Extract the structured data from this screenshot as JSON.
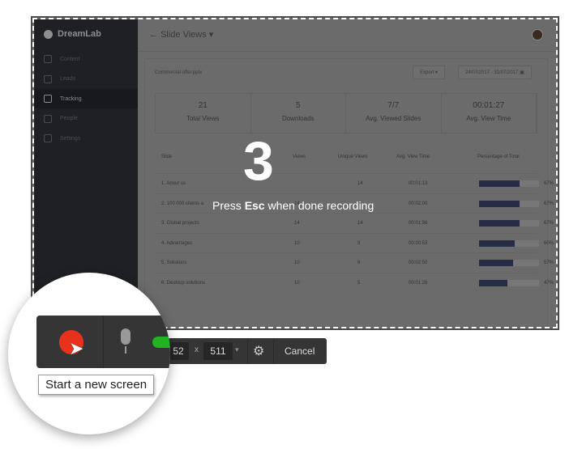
{
  "app": {
    "name": "DreamLab",
    "page_title": "Slide Views"
  },
  "sidebar": {
    "items": [
      {
        "label": "Content",
        "icon": "file-icon"
      },
      {
        "label": "Leads",
        "icon": "target-icon"
      },
      {
        "label": "Tracking",
        "icon": "chart-icon",
        "selected": true
      },
      {
        "label": "People",
        "icon": "people-icon"
      },
      {
        "label": "Settings",
        "icon": "gear-icon"
      }
    ]
  },
  "content": {
    "file": "Commercial offer.pptx",
    "export_label": "Export",
    "date_range": "24/07/2017 - 31/07/2017",
    "stats": [
      {
        "value": "21",
        "label": "Total Views"
      },
      {
        "value": "5",
        "label": "Downloads"
      },
      {
        "value": "7/7",
        "label": "Avg. Viewed Slides"
      },
      {
        "value": "00:01:27",
        "label": "Avg. View Time"
      }
    ],
    "columns": [
      "Slide",
      "Views",
      "Unique Views",
      "Avg. View Time",
      "Percentage of Total"
    ],
    "rows": [
      {
        "slide": "1. About us",
        "views": "",
        "unique": "14",
        "time": "00:01:13",
        "pct": "67%",
        "pct_value": 67
      },
      {
        "slide": "2. 100 000 clients a",
        "views": "14",
        "unique": "",
        "time": "00:02:00",
        "pct": "67%",
        "pct_value": 67
      },
      {
        "slide": "3. Global projects",
        "views": "14",
        "unique": "14",
        "time": "00:01:56",
        "pct": "67%",
        "pct_value": 67
      },
      {
        "slide": "4. Advantages",
        "views": "10",
        "unique": "9",
        "time": "00:00:53",
        "pct": "60%",
        "pct_value": 60
      },
      {
        "slide": "5. Solutions",
        "views": "10",
        "unique": "6",
        "time": "00:02:50",
        "pct": "57%",
        "pct_value": 57
      },
      {
        "slide": "6. Desktop solutions",
        "views": "10",
        "unique": "5",
        "time": "00:01:28",
        "pct": "47%",
        "pct_value": 47
      }
    ]
  },
  "overlay": {
    "countdown": "3",
    "press": "Press ",
    "key": "Esc",
    "rest": " when done recording"
  },
  "toolbar": {
    "width": "52",
    "x": "x",
    "height": "511",
    "cancel": "Cancel",
    "tooltip": "Start a new screen"
  },
  "colors": {
    "record": "#e8321e",
    "mic_toggle": "#21b321",
    "bar": "#272c45"
  }
}
